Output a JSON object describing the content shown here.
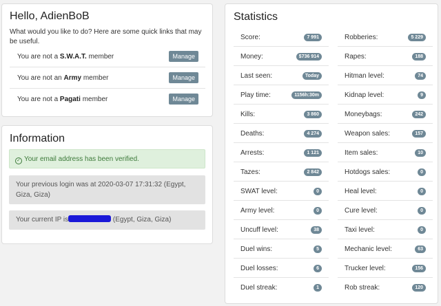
{
  "hello": {
    "title": "Hello, AdienBoB",
    "intro": "What would you like to do? Here are some quick links that may be useful.",
    "memberships": [
      {
        "prefix": "You are not a ",
        "group": "S.W.A.T.",
        "suffix": " member",
        "button": "Manage"
      },
      {
        "prefix": "You are not an ",
        "group": "Army",
        "suffix": " member",
        "button": "Manage"
      },
      {
        "prefix": "You are not a ",
        "group": "Pagati",
        "suffix": " member",
        "button": "Manage"
      }
    ]
  },
  "information": {
    "title": "Information",
    "verified": "Your email address has been verified.",
    "previous_login": "Your previous login was at 2020-03-07 17:31:32 (Egypt, Giza, Giza)",
    "ip_prefix": "Your current IP is",
    "ip_suffix": " (Egypt, Giza, Giza)"
  },
  "statistics": {
    "title": "Statistics",
    "left": [
      {
        "label": "Score:",
        "value": "7 991"
      },
      {
        "label": "Money:",
        "value": "$736 914"
      },
      {
        "label": "Last seen:",
        "value": "Today"
      },
      {
        "label": "Play time:",
        "value": "1156h:30m"
      },
      {
        "label": "Kills:",
        "value": "3 860"
      },
      {
        "label": "Deaths:",
        "value": "4 274"
      },
      {
        "label": "Arrests:",
        "value": "1 121"
      },
      {
        "label": "Tazes:",
        "value": "2 842"
      },
      {
        "label": "SWAT level:",
        "value": "0"
      },
      {
        "label": "Army level:",
        "value": "0"
      },
      {
        "label": "Uncuff level:",
        "value": "38"
      },
      {
        "label": "Duel wins:",
        "value": "5"
      },
      {
        "label": "Duel losses:",
        "value": "6"
      },
      {
        "label": "Duel streak:",
        "value": "1"
      }
    ],
    "right": [
      {
        "label": "Robberies:",
        "value": "5 229"
      },
      {
        "label": "Rapes:",
        "value": "188"
      },
      {
        "label": "Hitman level:",
        "value": "74"
      },
      {
        "label": "Kidnap level:",
        "value": "9"
      },
      {
        "label": "Moneybags:",
        "value": "242"
      },
      {
        "label": "Weapon sales:",
        "value": "157"
      },
      {
        "label": "Item sales:",
        "value": "10"
      },
      {
        "label": "Hotdogs sales:",
        "value": "0"
      },
      {
        "label": "Heal level:",
        "value": "0"
      },
      {
        "label": "Cure level:",
        "value": "0"
      },
      {
        "label": "Taxi level:",
        "value": "0"
      },
      {
        "label": "Mechanic level:",
        "value": "63"
      },
      {
        "label": "Trucker level:",
        "value": "156"
      },
      {
        "label": "Rob streak:",
        "value": "120"
      }
    ]
  },
  "colors": {
    "badge": "#6f8896",
    "button": "#6f8896",
    "success_bg": "#dff0dd",
    "success_text": "#3d7a3a",
    "muted_bg": "#e2e2e2",
    "redaction": "#1a18d8"
  },
  "icons": {
    "verified": "check-circle-icon"
  }
}
